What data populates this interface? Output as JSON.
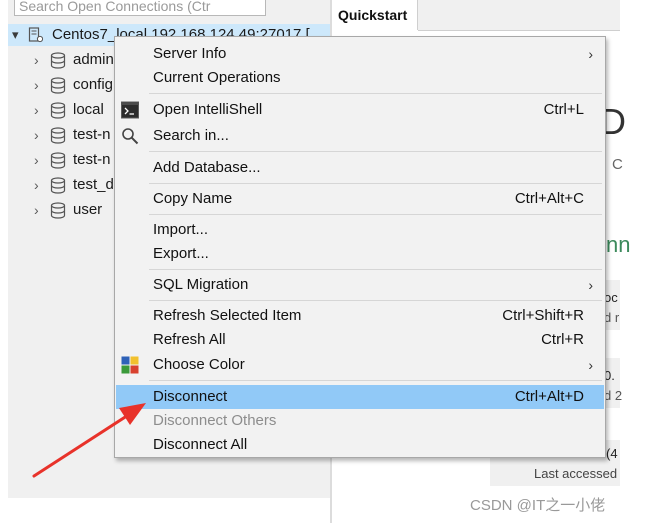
{
  "tree": {
    "search_placeholder": "Search Open Connections (Ctr",
    "connection_label": "Centos7_local 192.168.124.49:27017 [",
    "databases": [
      {
        "label": "admin"
      },
      {
        "label": "config"
      },
      {
        "label": "local"
      },
      {
        "label": "test-n"
      },
      {
        "label": "test-n"
      },
      {
        "label": "test_d"
      },
      {
        "label": "user"
      }
    ]
  },
  "tabs": {
    "quickstart": "Quickstart"
  },
  "right_peek": {
    "big_letter": "D",
    "small_c": "C",
    "section_nn": "nn",
    "card1_a": "oc",
    "card1_b": "d r",
    "card2_a": "0.",
    "card2_b": "d 2",
    "card3_a": "(4",
    "last_accessed": "Last accessed"
  },
  "menu": {
    "server_info": "Server Info",
    "current_operations": "Current Operations",
    "open_intellishell": "Open IntelliShell",
    "open_intellishell_sc": "Ctrl+L",
    "search_in": "Search in...",
    "add_database": "Add Database...",
    "copy_name": "Copy Name",
    "copy_name_sc": "Ctrl+Alt+C",
    "import": "Import...",
    "export": "Export...",
    "sql_migration": "SQL Migration",
    "refresh_selected": "Refresh Selected Item",
    "refresh_selected_sc": "Ctrl+Shift+R",
    "refresh_all": "Refresh All",
    "refresh_all_sc": "Ctrl+R",
    "choose_color": "Choose Color",
    "disconnect": "Disconnect",
    "disconnect_sc": "Ctrl+Alt+D",
    "disconnect_others": "Disconnect Others",
    "disconnect_all": "Disconnect All",
    "submenu_glyph": "›"
  },
  "watermark": "CSDN @IT之一小佬",
  "colors": {
    "highlight": "#91c9f7",
    "selected_row": "#cde8fb",
    "annotation_arrow": "#e8322a"
  }
}
